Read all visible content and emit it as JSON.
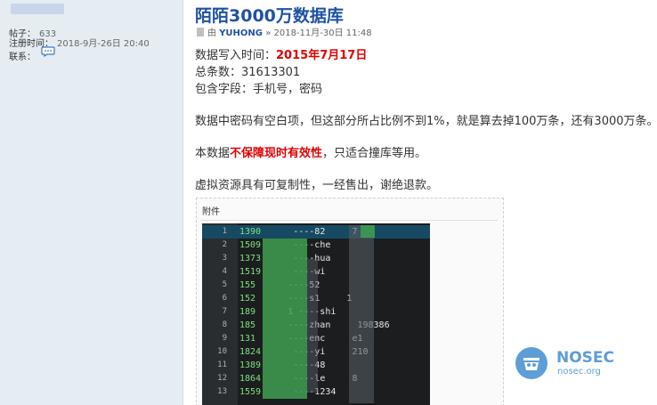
{
  "sidebar": {
    "stats": [
      {
        "label": "帖子：",
        "value": "633"
      },
      {
        "label": "注册时间：",
        "value": "2018-9月-26日 20:40"
      },
      {
        "label": "联系：",
        "value": ""
      }
    ]
  },
  "post": {
    "title": "陌陌3000万数据库",
    "byline_prefix": "由",
    "author": "YUHONG",
    "byline_sep": "»",
    "date": "2018-11月-30日 11:48",
    "write_time_label": "数据写入时间：",
    "write_time_value": "2015年7月17日",
    "total_line": "总条数：31613301",
    "fields_line": "包含字段：手机号，密码",
    "blank_note": "数据中密码有空白项，但这部分所占比例不到1%，就是算去掉100万条，还有3000万条。",
    "validity_prefix": "本数据",
    "validity_red": "不保障现时有效性",
    "validity_suffix": "，只适合撞库等用。",
    "refund_note": "虚拟资源具有可复制性，一经售出，谢绝退款。",
    "attachment_label": "附件"
  },
  "terminal": {
    "rows": [
      {
        "n": "1",
        "a": "1390",
        "b": "----82",
        "c": "7"
      },
      {
        "n": "2",
        "a": "1509",
        "b": "----che",
        "c": ""
      },
      {
        "n": "3",
        "a": "1373",
        "b": "----hua",
        "c": ""
      },
      {
        "n": "4",
        "a": "1519",
        "b": "----wi",
        "c": ""
      },
      {
        "n": "5",
        "a": "155",
        "b": "----52",
        "c": ""
      },
      {
        "n": "6",
        "a": "152",
        "b": "----s1",
        "c": "1"
      },
      {
        "n": "7",
        "a": "189",
        "b": "1 ----shi",
        "c": ""
      },
      {
        "n": "8",
        "a": "185",
        "b": "----zhan",
        "c": "198386"
      },
      {
        "n": "9",
        "a": "131",
        "b": "----enc",
        "c": "e1"
      },
      {
        "n": "10",
        "a": "1824",
        "b": "----yi",
        "c": "210"
      },
      {
        "n": "11",
        "a": "1389",
        "b": "----48",
        "c": ""
      },
      {
        "n": "12",
        "a": "1864",
        "b": "----le",
        "c": "8"
      },
      {
        "n": "13",
        "a": "1559",
        "b": "----1234",
        "c": ""
      }
    ]
  },
  "watermark": {
    "brand": "NOSEC",
    "domain": "nosec.org"
  },
  "colors": {
    "title": "#1f52a3",
    "emphasis": "#e00000",
    "sidebar_bg": "#e5edf2",
    "terminal_bg": "#1b1d1f"
  }
}
